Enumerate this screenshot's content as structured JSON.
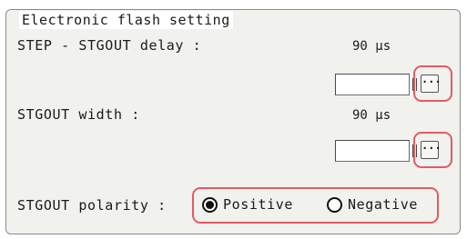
{
  "group_title": "Electronic flash setting",
  "delay": {
    "label": "STEP - STGOUT delay :",
    "value_display": "90 µs",
    "input_value": "",
    "browse_label": "···",
    "browse_icon": "ellipsis-icon"
  },
  "width": {
    "label": "STGOUT width :",
    "value_display": "90 µs",
    "input_value": "",
    "browse_label": "···",
    "browse_icon": "ellipsis-icon"
  },
  "polarity": {
    "label": "STGOUT polarity :",
    "options": [
      {
        "label": "Positive",
        "selected": true
      },
      {
        "label": "Negative",
        "selected": false
      }
    ]
  },
  "colors": {
    "highlight": "#e25b63",
    "panel_bg": "#f1f1ee"
  }
}
